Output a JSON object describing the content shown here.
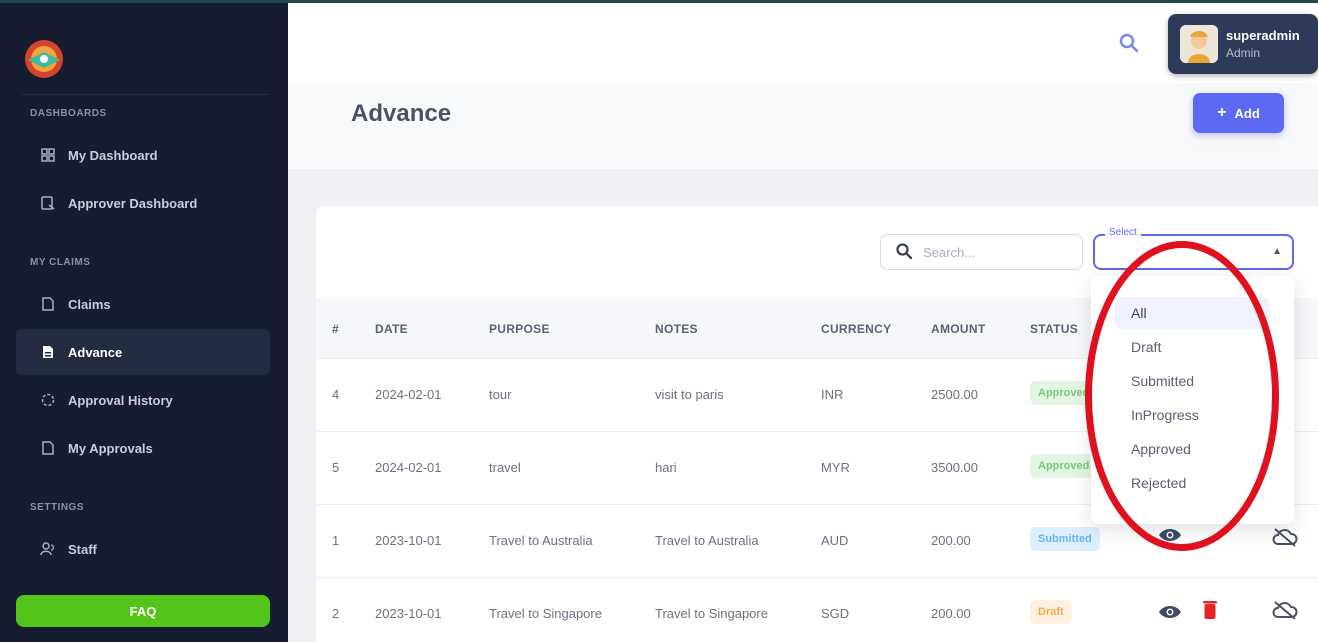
{
  "sidebar": {
    "sections": [
      {
        "title": "DASHBOARDS"
      },
      {
        "title": "MY CLAIMS"
      },
      {
        "title": "SETTINGS"
      }
    ],
    "items": [
      {
        "label": "My Dashboard",
        "icon": "dashboard-icon"
      },
      {
        "label": "Approver Dashboard",
        "icon": "approver-dashboard-icon"
      },
      {
        "label": "Claims",
        "icon": "document-icon"
      },
      {
        "label": "Advance",
        "icon": "document-icon",
        "active": true
      },
      {
        "label": "Approval History",
        "icon": "history-icon"
      },
      {
        "label": "My Approvals",
        "icon": "document-icon"
      },
      {
        "label": "Staff",
        "icon": "users-icon"
      }
    ],
    "faq_label": "FAQ"
  },
  "header": {
    "user": {
      "name": "superadmin",
      "role": "Admin"
    }
  },
  "page": {
    "title": "Advance",
    "add_label": "Add"
  },
  "filters": {
    "search_placeholder": "Search...",
    "select_label": "Select",
    "options": [
      "All",
      "Draft",
      "Submitted",
      "InProgress",
      "Approved",
      "Rejected"
    ],
    "highlighted_option": "All"
  },
  "table": {
    "columns": [
      "#",
      "DATE",
      "PURPOSE",
      "NOTES",
      "CURRENCY",
      "AMOUNT",
      "STATUS"
    ],
    "rows": [
      {
        "num": "4",
        "date": "2024-02-01",
        "purpose": "tour",
        "notes": "visit to paris",
        "currency": "INR",
        "amount": "2500.00",
        "status": "Approved"
      },
      {
        "num": "5",
        "date": "2024-02-01",
        "purpose": "travel",
        "notes": "hari",
        "currency": "MYR",
        "amount": "3500.00",
        "status": "Approved"
      },
      {
        "num": "1",
        "date": "2023-10-01",
        "purpose": "Travel to Australia",
        "notes": "Travel to Australia",
        "currency": "AUD",
        "amount": "200.00",
        "status": "Submitted"
      },
      {
        "num": "2",
        "date": "2023-10-01",
        "purpose": "Travel to Singapore",
        "notes": "Travel to Singapore",
        "currency": "SGD",
        "amount": "200.00",
        "status": "Draft"
      }
    ]
  },
  "colors": {
    "sidebar_bg": "#161d31",
    "accent": "#5d68f3",
    "faq": "#52c41a",
    "annotation": "#e0111e"
  }
}
